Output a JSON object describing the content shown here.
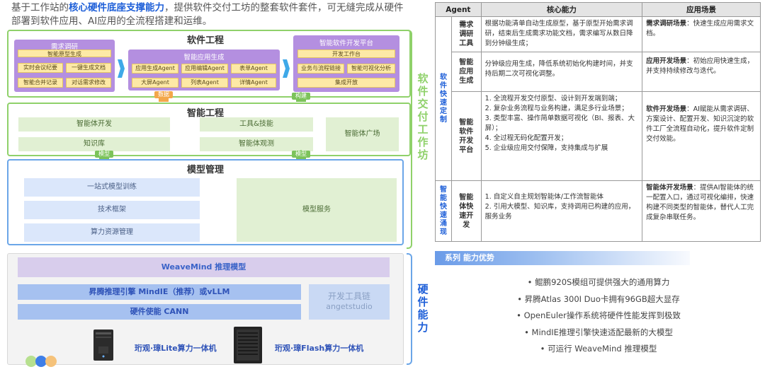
{
  "intro": {
    "pre": "基于工作站的",
    "highlight": "核心硬件底座支撑能力",
    "post": "，提供软件交付工坊的整套软件套件，可无缝完成从硬件部署到软件应用、AI应用的全流程搭建和运维。"
  },
  "software_engineering": {
    "title": "软件工程",
    "requirements": {
      "title": "需求调研",
      "items": [
        "智能原型生成",
        "实时会议纪要",
        "一键生成文档",
        "智能合并记录",
        "对话需求修改"
      ]
    },
    "app_gen": {
      "title": "智能应用生成",
      "items": [
        "应用生成Agent",
        "应用编辑Agent",
        "表单Agent",
        "大屏Agent",
        "列表Agent",
        "详情Agent"
      ]
    },
    "dev_platform": {
      "title": "智能软件开发平台",
      "items": [
        "开发工作台",
        "业务与流程链接",
        "智能可视化分析",
        "集成开放"
      ]
    },
    "tag_data": "数据",
    "tag_build": "构建"
  },
  "intelligent_engineering": {
    "title": "智能工程",
    "items": [
      "智能体开发",
      "工具&技能",
      "知识库",
      "智能体观测",
      "智能体广场"
    ],
    "tag_left": "模型",
    "tag_right": "模型"
  },
  "model_management": {
    "title": "模型管理",
    "items": [
      "一站式模型训练",
      "技术框架",
      "算力资源管理",
      "模型服务"
    ]
  },
  "hardware": {
    "inference_model": "WeaveMind  推理模型",
    "engine": "昇腾推理引擎 MindIE（推荐）或vLLM",
    "cann": "硬件使能 CANN",
    "toolchain_line1": "开发工具链",
    "toolchain_line2": "angetstudio",
    "lite": "珩观·璋Lite算力一体机",
    "flash": "珩观·璋Flash算力一体机"
  },
  "side_labels": {
    "software": [
      "软",
      "件",
      "交",
      "付",
      "工",
      "作",
      "坊"
    ],
    "hardware": [
      "硬",
      "件",
      "能",
      "力"
    ]
  },
  "table": {
    "headers": [
      "Agent",
      "核心能力",
      "应用场景"
    ],
    "group1": [
      "软",
      "件",
      "快",
      "速",
      "定",
      "制"
    ],
    "group2": [
      "智",
      "能",
      "快",
      "速",
      "涌",
      "现"
    ],
    "rows": [
      {
        "agent": [
          "需求",
          "调研",
          "工具"
        ],
        "capability": "根据功能清单自动生成原型，基于原型开始需求调研，结束后生成需求功能文档，需求编写从数日降到分钟级生成；",
        "scene_title": "需求调研场景",
        "scene_text": "：快速生成应用需求文档。"
      },
      {
        "agent": [
          "智能",
          "应用",
          "生成"
        ],
        "capability": "分钟级应用生成，降低系统初始化构建时间，并支持后期二次可视化调整。",
        "scene_title": "应用开发场景",
        "scene_text": "：初始应用快速生成，并支持持续修改与迭代。"
      },
      {
        "agent": [
          "智能",
          "软件",
          "开发",
          "平台"
        ],
        "capability_list": [
          "1. 全流程开发交付原型、设计到开发端到端；",
          "2. 复杂业务流程与业务构建，满足多行业场景；",
          "3. 类型丰富、操作简单数据可视化（BI、报表、大屏）；",
          "4. 全过程无码化配置开发；",
          "5. 企业级应用交付保障，支持集成与扩展"
        ],
        "scene_title": "软件开发场景",
        "scene_text": "：AI赋能从需求调研、方案设计、配置开发、知识沉淀的软件工厂全流程自动化，提升软件定制交付效能。"
      },
      {
        "agent": [
          "智能",
          "体快",
          "速开",
          "发"
        ],
        "capability_list": [
          "1. 自定义自主规划智能体/工作流智能体",
          "2. 引用大模型、知识库，支持调用已构建的应用，服务业务"
        ],
        "scene_title": "智能体开发场景",
        "scene_text": "：提供AI智能体的统一配置入口，通过可视化编排，快速构建不同类型的智能体，替代人工完成复杂串联任务。"
      }
    ]
  },
  "advantages": {
    "title": "系列 能力优势",
    "items": [
      "• 鲲鹏920S模组可提供强大的通用算力",
      "• 昇腾Atlas 300I Duo卡拥有96GB超大显存",
      "• OpenEuler操作系统将硬件性能发挥到极致",
      "• MindIE推理引擎快速适配最新的大模型",
      "• 可运行 WeaveMind 推理模型"
    ]
  },
  "colors": {
    "green": "#8fd16a",
    "blue": "#1e5fd8",
    "purple": "#b48fe0",
    "orange": "#f3a74a"
  }
}
